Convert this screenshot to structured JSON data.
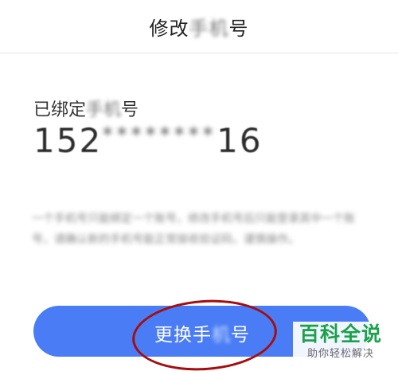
{
  "header": {
    "title_prefix": "修改",
    "title_blur": "手机",
    "title_suffix": "号"
  },
  "bound": {
    "label_prefix": "已绑定",
    "label_blur": "手机",
    "label_suffix": "号"
  },
  "phone": {
    "start": "152",
    "masked": "********",
    "end": "16"
  },
  "description": "一个手机号只能绑定一个账号，修改手机号后只能登录其中一个账号，请确认新的手机号能正常接收验证码，谨慎操作。",
  "button": {
    "prefix": "更换手",
    "blur": "机",
    "suffix": "号"
  },
  "watermark": {
    "logo": "百科全说",
    "tagline": "助你轻松解决"
  }
}
